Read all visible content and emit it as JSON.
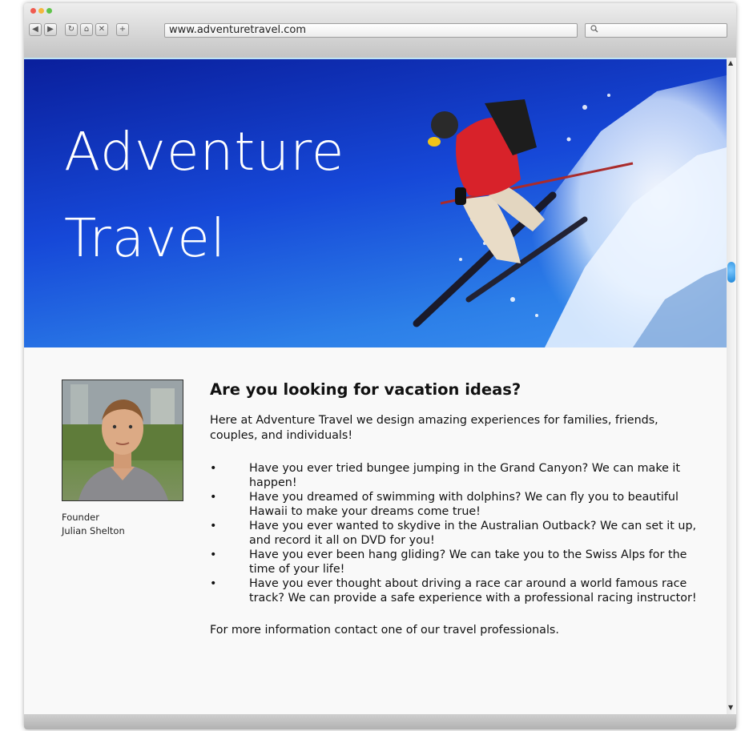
{
  "browser": {
    "url": "www.adventuretravel.com",
    "nav_icons": [
      "back-icon",
      "forward-icon",
      "reload-icon",
      "home-icon",
      "stop-icon",
      "new-tab-icon"
    ],
    "search_icon": "search-icon",
    "traffic_light_colors": [
      "#f05a4f",
      "#f4b73d",
      "#5ec34a"
    ]
  },
  "hero": {
    "title_line1": "Adventure",
    "title_line2": "Travel"
  },
  "profile": {
    "role": "Founder",
    "name": "Julian Shelton"
  },
  "main": {
    "heading": "Are you looking for vacation ideas?",
    "intro": "Here at Adventure Travel we design amazing experiences for families, friends, couples, and individuals!",
    "bullets": [
      "Have you ever tried bungee jumping in the Grand Canyon? We can make it happen!",
      "Have you dreamed of swimming with dolphins? We can fly you to beautiful Hawaii to make your dreams come true!",
      "Have you ever wanted to skydive in the Australian Outback? We can set it up, and record it all on DVD for you!",
      "Have you ever been hang gliding? We can take you to the Swiss Alps for the time of your life!",
      "Have you ever thought about driving a race car around a world famous race track? We can provide a safe experience with a professional racing instructor!"
    ],
    "outro": "For more information contact one of our travel professionals."
  }
}
